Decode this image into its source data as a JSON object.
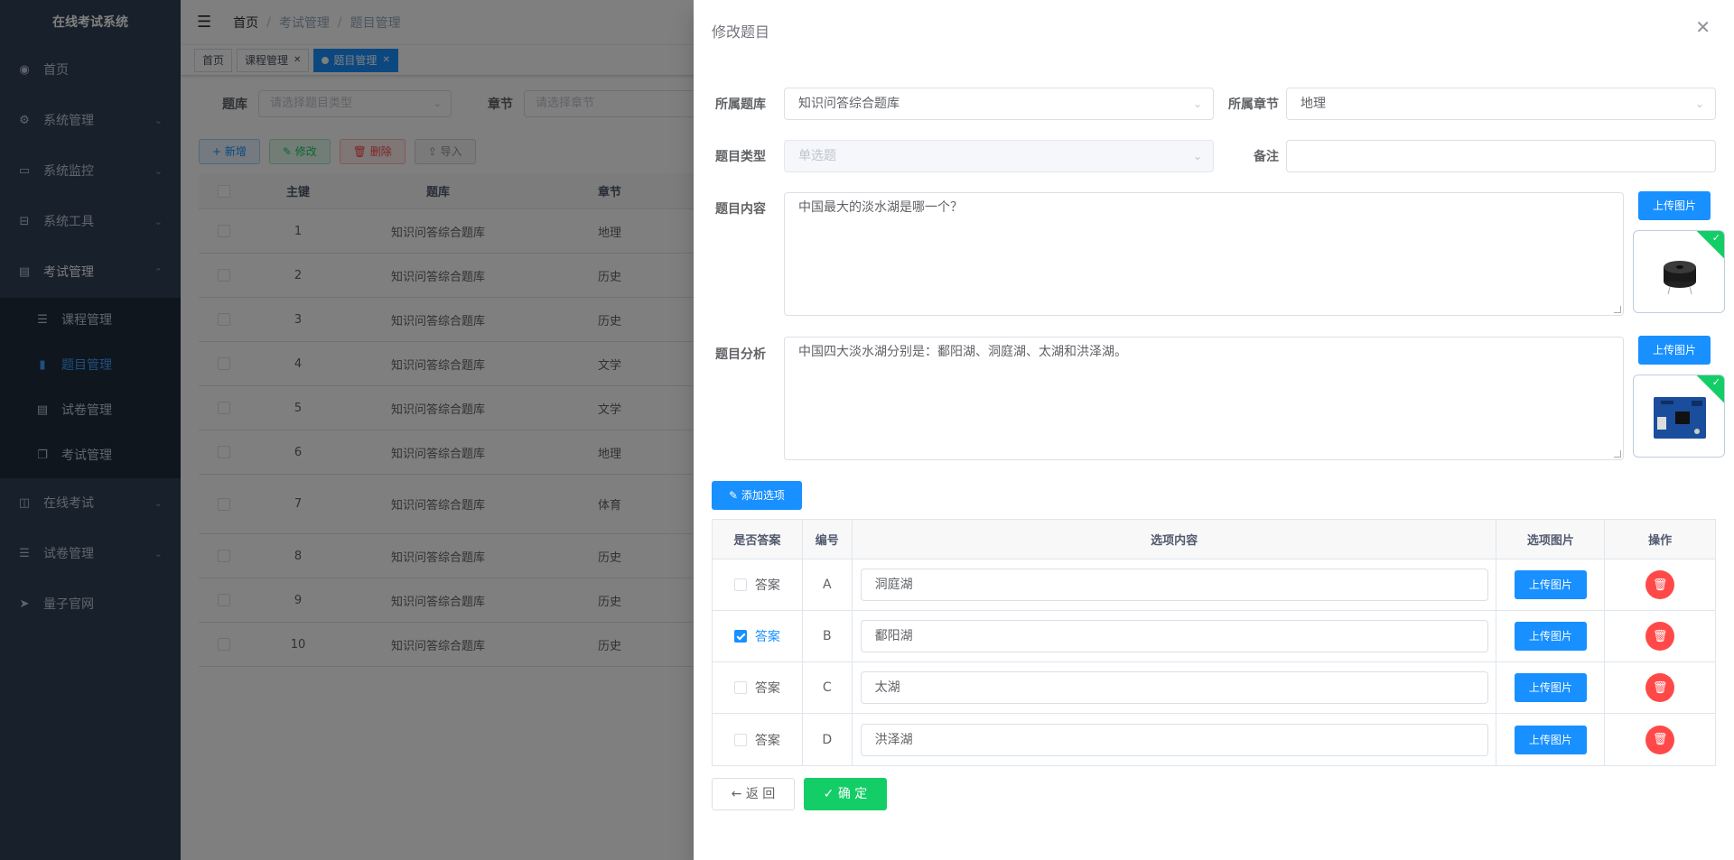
{
  "app_title": "在线考试系统",
  "sidebar": {
    "items": [
      {
        "label": "首页",
        "icon": "dashboard-icon"
      },
      {
        "label": "系统管理",
        "icon": "gear-icon"
      },
      {
        "label": "系统监控",
        "icon": "monitor-icon"
      },
      {
        "label": "系统工具",
        "icon": "toolbox-icon"
      },
      {
        "label": "考试管理",
        "icon": "document-icon"
      }
    ],
    "sub_items": [
      {
        "label": "课程管理",
        "icon": "list-icon"
      },
      {
        "label": "题目管理",
        "icon": "book-icon"
      },
      {
        "label": "试卷管理",
        "icon": "paper-icon"
      },
      {
        "label": "考试管理",
        "icon": "copy-icon"
      }
    ],
    "after_items": [
      {
        "label": "在线考试",
        "icon": "columns-icon"
      },
      {
        "label": "试卷管理",
        "icon": "list-icon"
      },
      {
        "label": "量子官网",
        "icon": "send-icon"
      }
    ]
  },
  "breadcrumb": [
    "首页",
    "考试管理",
    "题目管理"
  ],
  "tags": [
    "首页",
    "课程管理",
    "题目管理"
  ],
  "search": {
    "bank_label": "题库",
    "bank_placeholder": "请选择题目类型",
    "chapter_label": "章节",
    "chapter_placeholder": "请选择章节"
  },
  "toolbar": {
    "add": "+ 新增",
    "edit": "✎ 修改",
    "delete": "🗑 删除",
    "import": "⇪ 导入"
  },
  "table": {
    "headers": [
      "主键",
      "题库",
      "章节"
    ],
    "rows": [
      [
        "1",
        "知识问答综合题库",
        "地理"
      ],
      [
        "2",
        "知识问答综合题库",
        "历史"
      ],
      [
        "3",
        "知识问答综合题库",
        "历史"
      ],
      [
        "4",
        "知识问答综合题库",
        "文学"
      ],
      [
        "5",
        "知识问答综合题库",
        "文学"
      ],
      [
        "6",
        "知识问答综合题库",
        "地理"
      ],
      [
        "7",
        "知识问答综合题库",
        "体育"
      ],
      [
        "8",
        "知识问答综合题库",
        "历史"
      ],
      [
        "9",
        "知识问答综合题库",
        "历史"
      ],
      [
        "10",
        "知识问答综合题库",
        "历史"
      ]
    ]
  },
  "drawer": {
    "title": "修改题目",
    "bank_label": "所属题库",
    "bank_value": "知识问答综合题库",
    "chapter_label": "所属章节",
    "chapter_value": "地理",
    "type_label": "题目类型",
    "type_value": "单选题",
    "remark_label": "备注",
    "remark_value": "",
    "content_label": "题目内容",
    "content_value": "中国最大的淡水湖是哪一个？",
    "analysis_label": "题目分析",
    "analysis_value": "中国四大淡水湖分别是：鄱阳湖、洞庭湖、太湖和洪泽湖。",
    "upload_label": "上传图片",
    "add_option_label": "添加选项",
    "option_headers": [
      "是否答案",
      "编号",
      "选项内容",
      "选项图片",
      "操作"
    ],
    "answer_label": "答案",
    "options": [
      {
        "code": "A",
        "content": "洞庭湖",
        "checked": false
      },
      {
        "code": "B",
        "content": "鄱阳湖",
        "checked": true
      },
      {
        "code": "C",
        "content": "太湖",
        "checked": false
      },
      {
        "code": "D",
        "content": "洪泽湖",
        "checked": false
      }
    ],
    "back_label": "返 回",
    "confirm_label": "确 定"
  },
  "colors": {
    "primary": "#1890ff",
    "success": "#13ce66",
    "danger": "#ff4949",
    "sidebar": "#304156"
  }
}
